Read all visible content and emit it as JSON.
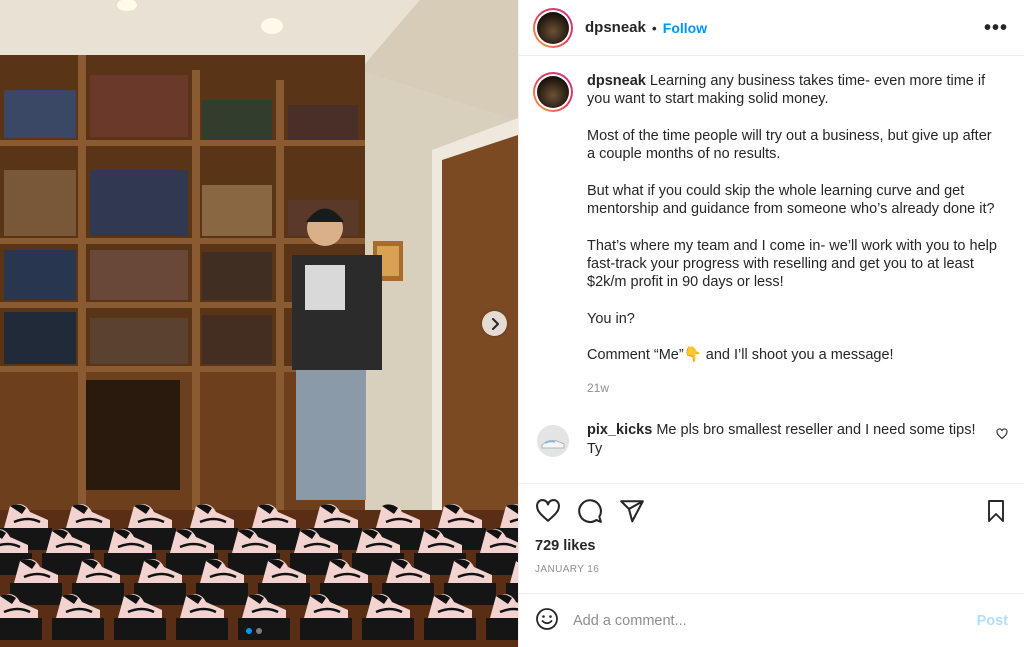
{
  "post": {
    "username": "dpsneak",
    "separator": "•",
    "follow_label": "Follow",
    "more_label": "•••",
    "caption": {
      "username": "dpsneak",
      "paragraphs": [
        "Learning any business takes time- even more time if you want to start making solid money.",
        "Most of the time people will try out a business, but give up after a couple months of no results.",
        "But what if you could skip the whole learning curve and get mentorship and guidance from someone who’s already done it?",
        "That’s where my team and I come in- we’ll work with you to help fast-track your progress with reselling and get you to at least $2k/m profit in 90 days or less!",
        "You in?",
        "Comment “Me”👇 and I’ll shoot you a message!"
      ],
      "time": "21w"
    },
    "comment": {
      "username": "pix_kicks",
      "text": "Me pls bro smallest reseller and I need some tips! Ty"
    },
    "likes": "729 likes",
    "date": "JANUARY 16",
    "add_comment_placeholder": "Add a comment...",
    "post_label": "Post"
  },
  "carousel": {
    "slide_count": 2,
    "active_slide": 1
  },
  "colors": {
    "accent": "#0095f6",
    "post_disabled": "#b2dffc",
    "muted": "#8e8e8e"
  },
  "icons": {
    "next": "chevron-right-icon",
    "like": "heart-icon",
    "comment": "comment-icon",
    "share": "paper-plane-icon",
    "save": "bookmark-icon",
    "emoji": "emoji-icon",
    "more": "more-icon"
  }
}
